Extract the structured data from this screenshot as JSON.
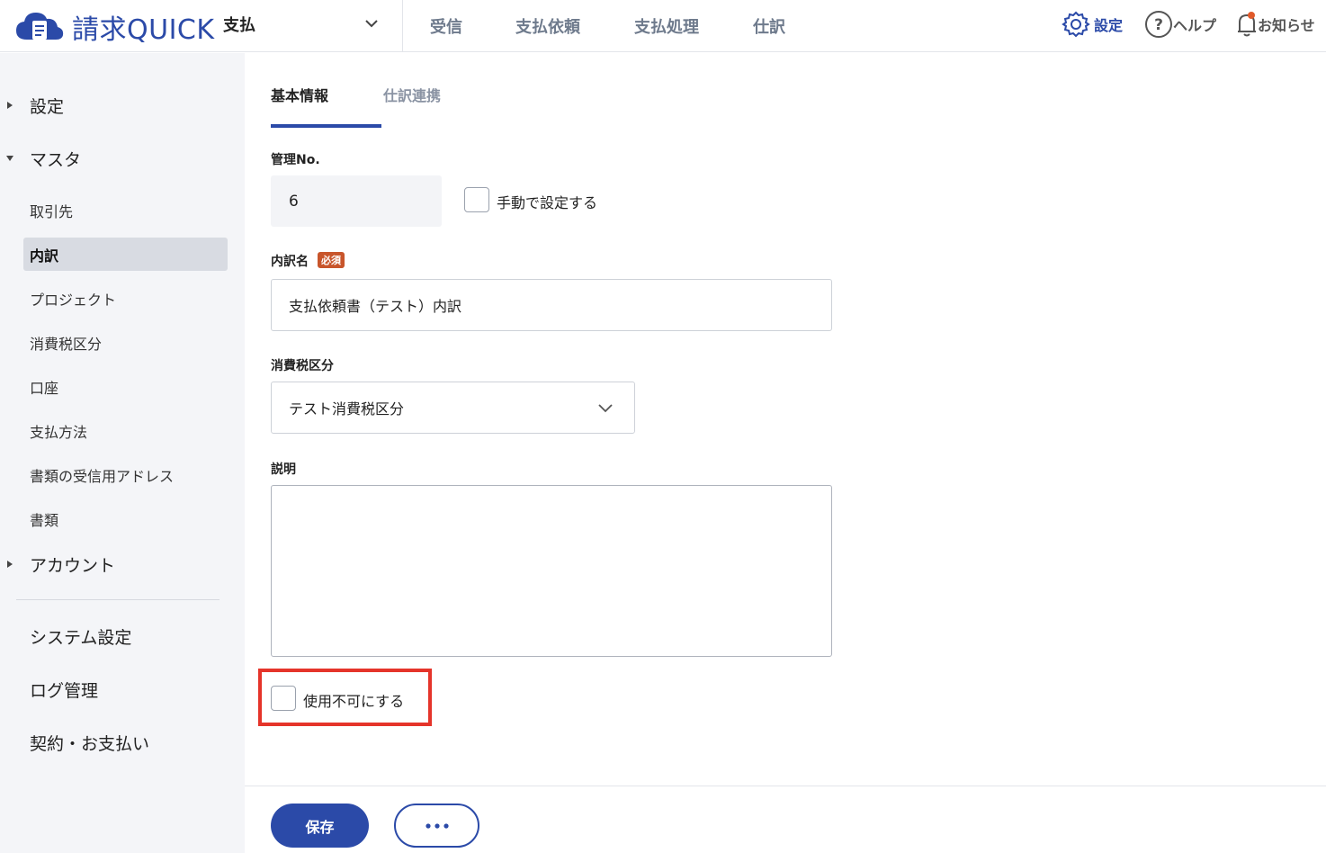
{
  "header": {
    "logo_text": "請求QUICK",
    "product": "支払",
    "nav": [
      "受信",
      "支払依頼",
      "支払処理",
      "仕訳"
    ],
    "settings_label": "設定",
    "help_label": "ヘルプ",
    "notice_label": "お知らせ"
  },
  "sidebar": {
    "group_settings": "設定",
    "group_master": "マスタ",
    "items": [
      "取引先",
      "内訳",
      "プロジェクト",
      "消費税区分",
      "口座",
      "支払方法",
      "書類の受信用アドレス",
      "書類"
    ],
    "group_account": "アカウント",
    "bottom": [
      "システム設定",
      "ログ管理",
      "契約・お支払い"
    ]
  },
  "tabs": {
    "basic": "基本情報",
    "journal": "仕訳連携"
  },
  "form": {
    "mgmt_no_label": "管理No.",
    "mgmt_no_value": "6",
    "manual_label": "手動で設定する",
    "name_label": "内訳名",
    "required": "必須",
    "name_value": "支払依頼書（テスト）内訳",
    "tax_label": "消費税区分",
    "tax_value": "テスト消費税区分",
    "desc_label": "説明",
    "disable_label": "使用不可にする"
  },
  "footer": {
    "save_label": "保存"
  },
  "colors": {
    "brand": "#2b4aa8",
    "highlight": "#e5342a",
    "required_badge": "#c8552b"
  }
}
